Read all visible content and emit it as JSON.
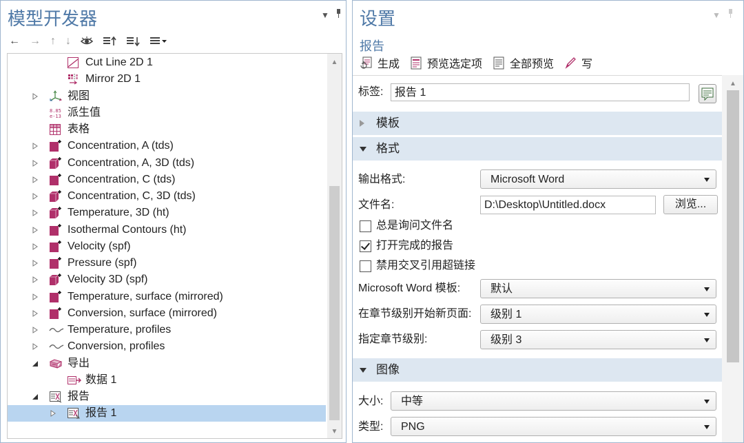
{
  "left": {
    "title": "模型开发器",
    "tree": [
      {
        "label": "Cut Line 2D 1",
        "indent": 2,
        "icon": "cut-line-icon"
      },
      {
        "label": "Mirror 2D 1",
        "indent": 2,
        "icon": "mirror-icon"
      },
      {
        "label": "视图",
        "indent": 1,
        "icon": "axes-icon",
        "toggle": "collapsed"
      },
      {
        "label": "派生值",
        "indent": 1,
        "icon": "derived-values-icon"
      },
      {
        "label": "表格",
        "indent": 1,
        "icon": "table-icon"
      },
      {
        "label": "Concentration, A (tds)",
        "indent": 1,
        "icon": "plot-group-2d-icon",
        "toggle": "collapsed"
      },
      {
        "label": "Concentration, A, 3D (tds)",
        "indent": 1,
        "icon": "plot-group-3d-icon",
        "toggle": "collapsed"
      },
      {
        "label": "Concentration, C (tds)",
        "indent": 1,
        "icon": "plot-group-2d-icon",
        "toggle": "collapsed"
      },
      {
        "label": "Concentration, C, 3D (tds)",
        "indent": 1,
        "icon": "plot-group-3d-icon",
        "toggle": "collapsed"
      },
      {
        "label": "Temperature, 3D (ht)",
        "indent": 1,
        "icon": "plot-group-3d-icon",
        "toggle": "collapsed"
      },
      {
        "label": "Isothermal Contours (ht)",
        "indent": 1,
        "icon": "plot-group-2d-icon",
        "toggle": "collapsed"
      },
      {
        "label": "Velocity (spf)",
        "indent": 1,
        "icon": "plot-group-2d-icon",
        "toggle": "collapsed"
      },
      {
        "label": "Pressure (spf)",
        "indent": 1,
        "icon": "plot-group-2d-icon",
        "toggle": "collapsed"
      },
      {
        "label": "Velocity 3D (spf)",
        "indent": 1,
        "icon": "plot-group-3d-icon",
        "toggle": "collapsed"
      },
      {
        "label": "Temperature, surface (mirrored)",
        "indent": 1,
        "icon": "plot-group-2d-icon",
        "toggle": "collapsed"
      },
      {
        "label": "Conversion, surface (mirrored)",
        "indent": 1,
        "icon": "plot-group-2d-icon",
        "toggle": "collapsed"
      },
      {
        "label": "Temperature, profiles",
        "indent": 1,
        "icon": "line-plot-icon",
        "toggle": "collapsed"
      },
      {
        "label": "Conversion, profiles",
        "indent": 1,
        "icon": "line-plot-icon",
        "toggle": "collapsed"
      },
      {
        "label": "导出",
        "indent": 1,
        "icon": "export-icon",
        "toggle": "expanded"
      },
      {
        "label": "数据 1",
        "indent": 2,
        "icon": "data-export-icon"
      },
      {
        "label": "报告",
        "indent": 1,
        "icon": "reports-icon",
        "toggle": "expanded"
      },
      {
        "label": "报告 1",
        "indent": 2,
        "icon": "report-icon",
        "toggle": "collapsed-hollow",
        "selected": true
      }
    ]
  },
  "right": {
    "title": "设置",
    "subtitle": "报告",
    "toolbar": {
      "generate": "生成",
      "preview_selected": "预览选定项",
      "preview_all": "全部预览",
      "write": "写"
    },
    "label_field": {
      "label": "标签:",
      "value": "报告 1"
    },
    "sections": {
      "template": "模板",
      "format": "格式",
      "image": "图像"
    },
    "format": {
      "output_format_label": "输出格式:",
      "output_format_value": "Microsoft Word",
      "filename_label": "文件名:",
      "filename_value": "D:\\Desktop\\Untitled.docx",
      "browse": "浏览...",
      "always_ask": "总是询问文件名",
      "open_finished": "打开完成的报告",
      "disable_links": "禁用交叉引用超链接",
      "word_template_label": "Microsoft Word 模板:",
      "word_template_value": "默认",
      "new_page_label": "在章节级别开始新页面:",
      "new_page_value": "级别 1",
      "chapter_level_label": "指定章节级别:",
      "chapter_level_value": "级别 3"
    },
    "image": {
      "size_label": "大小:",
      "size_value": "中等",
      "type_label": "类型:",
      "type_value": "PNG"
    }
  },
  "colors": {
    "title": "#4f79a7",
    "selection": "#b9d5f0",
    "section_bg": "#dde7f1",
    "plot_icon": "#b0306a"
  }
}
